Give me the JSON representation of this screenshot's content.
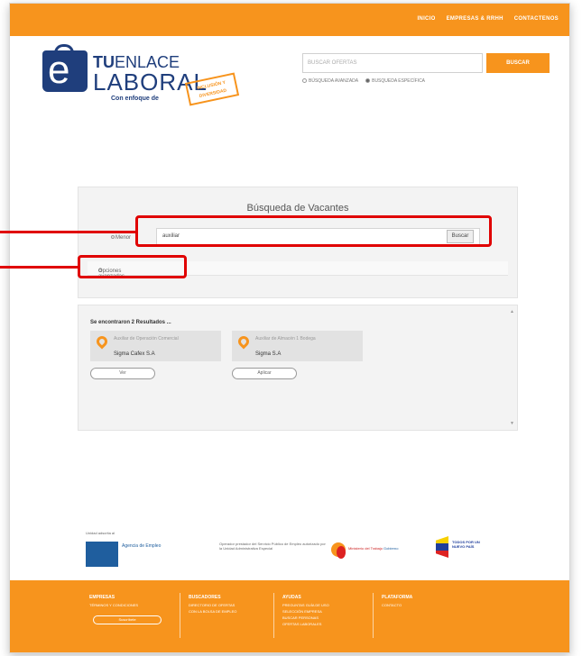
{
  "topnav": {
    "items": [
      "INICIO",
      "EMPRESAS & RRHH",
      "CONTACTENOS"
    ]
  },
  "logo": {
    "tu": "TU",
    "enlace": "ENLACE",
    "laboral": "LABORAL",
    "sub": "Con enfoque de",
    "stamp": "INCLUSIÓN Y DIVERSIDAD"
  },
  "header_search": {
    "placeholder": "BUSCAR OFERTAS",
    "button": "BUSCAR",
    "options": [
      "BÚSQUEDA AVANZADA",
      "BUSQUEDA ESPECÍFICA"
    ]
  },
  "search_panel": {
    "title": "Búsqueda de Vacantes",
    "field_label": "Menor",
    "query": "auxiliar",
    "button": "Buscar",
    "advanced_label": "Opciones avanzadas"
  },
  "results": {
    "count_text": "Se encontraron 2 Resultados ...",
    "cards": [
      {
        "meta": "Auxiliar de Operación Comercial",
        "company": "Sigma Cafex S.A",
        "action": "Ver"
      },
      {
        "meta": "Auxiliar de Almacén 1 Bodega",
        "company": "Sigma S.A",
        "action": "Aplicar"
      }
    ]
  },
  "partners": {
    "servicio": "Unidad adscrita al",
    "agencia": "Agencia de Empleo",
    "description": "Operador prestador del Servicio Público de Empleo autorizado por la Unidad Administrativa Especial",
    "mintrabajo": "Ministerio del Trabajo",
    "gobierno": "Gobierno",
    "prosperidad": "TODOS POR UN NUEVO PAÍS"
  },
  "footer": {
    "columns": [
      {
        "title": "EMPRESAS",
        "items": [
          "TÉRMINOS Y CONDICIONES"
        ]
      },
      {
        "title": "BUSCADORES",
        "items": [
          "DIRECTORIO DE OFERTAS",
          "CON LA BOLSA DE EMPLEO"
        ]
      },
      {
        "title": "AYUDAS",
        "items": [
          "PREGUNTAS GUÍA DE USO",
          "SELECCIÓN EMPRESA",
          "BUSCAR PERSONAS",
          "OFERTAS LABORALES"
        ]
      },
      {
        "title": "PLATAFORMA",
        "items": [
          "CONTACTO"
        ]
      }
    ],
    "button": "Suscríbete"
  }
}
